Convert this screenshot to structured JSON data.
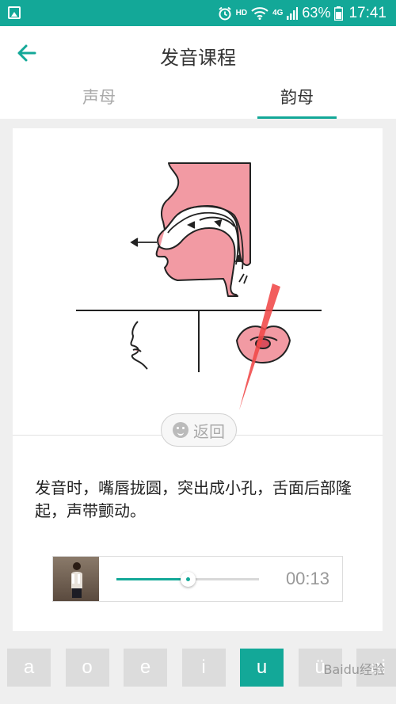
{
  "status_bar": {
    "network": "HD",
    "signal_label": "4G",
    "battery": "63%",
    "time": "17:41"
  },
  "header": {
    "title": "发音课程"
  },
  "tabs": [
    {
      "label": "声母",
      "active": false
    },
    {
      "label": "韵母",
      "active": true
    }
  ],
  "card": {
    "return_label": "返回",
    "description": "发音时，嘴唇拢圆，突出成小孔，舌面后部隆起，声带颤动。"
  },
  "player": {
    "progress": 0.5,
    "time": "00:13"
  },
  "keys": [
    "a",
    "o",
    "e",
    "i",
    "u",
    "ü",
    "ai"
  ],
  "active_key": "u",
  "watermark": "Baidu经验",
  "colors": {
    "accent": "#13a898",
    "diagram_pink": "#f29aa3",
    "annotation_red": "#f04848"
  }
}
